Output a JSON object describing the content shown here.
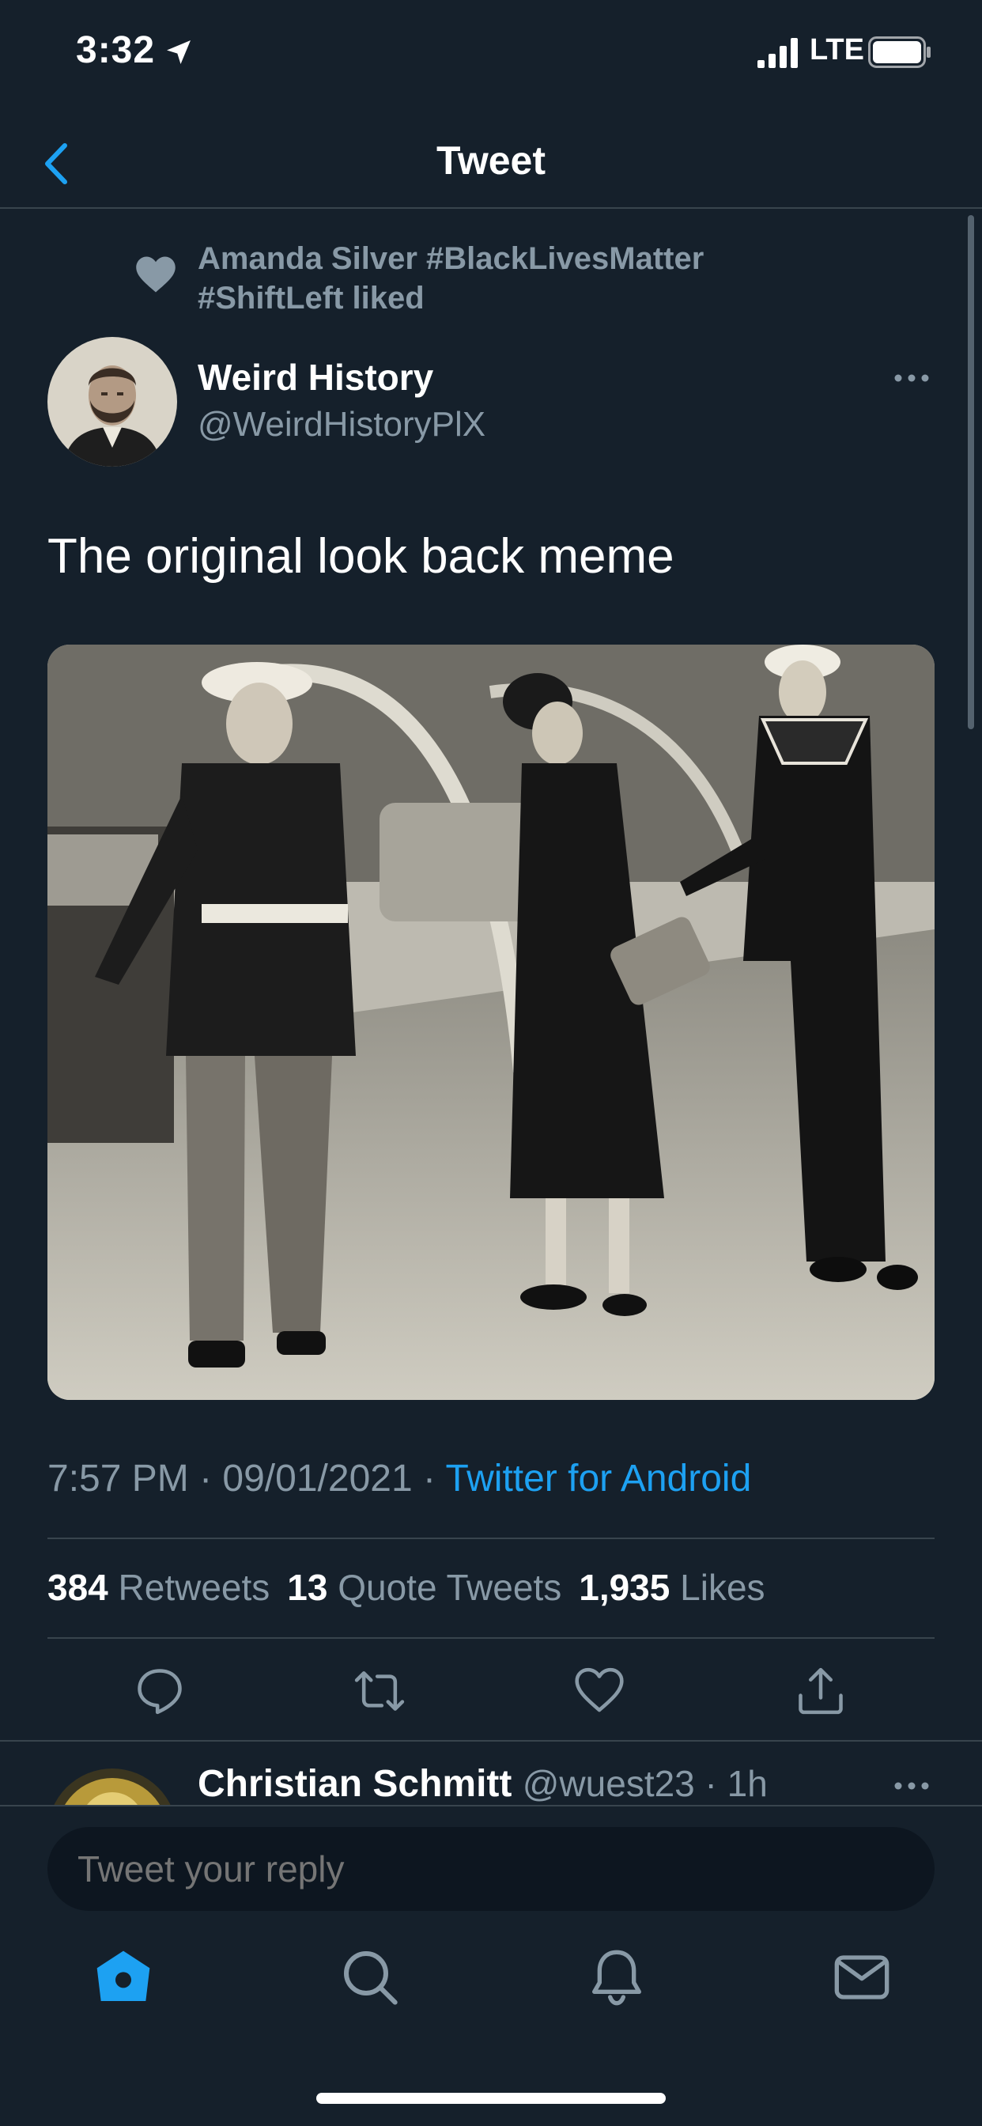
{
  "status_bar": {
    "time": "3:32",
    "network": "LTE",
    "icons": [
      "location-arrow-icon",
      "signal-icon",
      "battery-icon"
    ]
  },
  "nav": {
    "title": "Tweet",
    "back_icon": "chevron-left-icon"
  },
  "social_context": {
    "text": "Amanda Silver #BlackLivesMatter #ShiftLeft liked",
    "icon": "heart-icon"
  },
  "tweet": {
    "author_name": "Weird History",
    "author_handle": "@WeirdHistoryPlX",
    "text": "The original look back meme",
    "timestamp": "7:57 PM · 09/01/2021 · ",
    "source": "Twitter for Android",
    "stats": {
      "retweets_count": "384",
      "retweets_label": "Retweets",
      "quotes_count": "13",
      "quotes_label": "Quote Tweets",
      "likes_count": "1,935",
      "likes_label": "Likes"
    },
    "actions": [
      "reply-icon",
      "retweet-icon",
      "like-icon",
      "share-icon"
    ]
  },
  "reply": {
    "name": "Christian Schmitt",
    "handle": "@wuest23 · 1h"
  },
  "compose": {
    "placeholder": "Tweet your reply"
  },
  "tabbar": {
    "items": [
      "home-icon",
      "search-icon",
      "notifications-icon",
      "messages-icon"
    ],
    "active": "home-icon"
  },
  "colors": {
    "background": "#15202b",
    "accent": "#1da1f2",
    "secondary_text": "#8899a6",
    "divider": "#38444d"
  }
}
